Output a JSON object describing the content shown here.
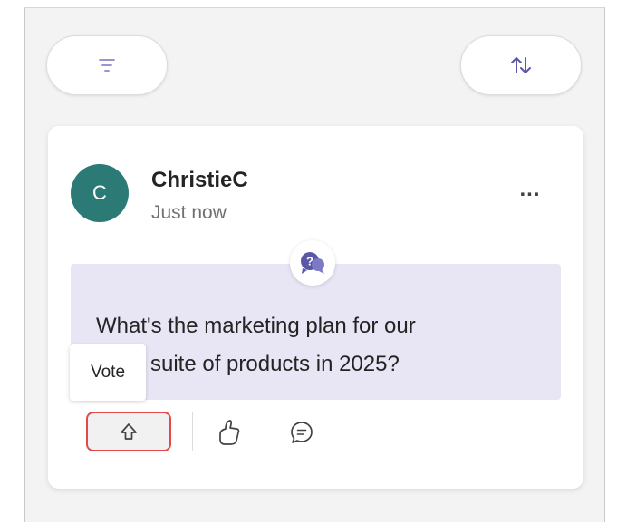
{
  "toolbar": {
    "filter_icon": "filter-icon",
    "sort_icon": "sort-icon"
  },
  "post": {
    "avatar_initial": "C",
    "avatar_color": "#2c7a76",
    "author": "ChristieC",
    "timestamp": "Just now",
    "more_label": "...",
    "question_icon": "question-bubble-icon",
    "question_lines": [
      "What's the marketing plan for our",
      "suite of products in 2025?"
    ],
    "question_bg": "#e8e6f5"
  },
  "actions": {
    "vote_tooltip": "Vote",
    "vote_icon": "upvote-arrow-icon",
    "like_icon": "thumbs-up-icon",
    "comment_icon": "comment-icon",
    "highlight_color": "#e24a4a"
  }
}
